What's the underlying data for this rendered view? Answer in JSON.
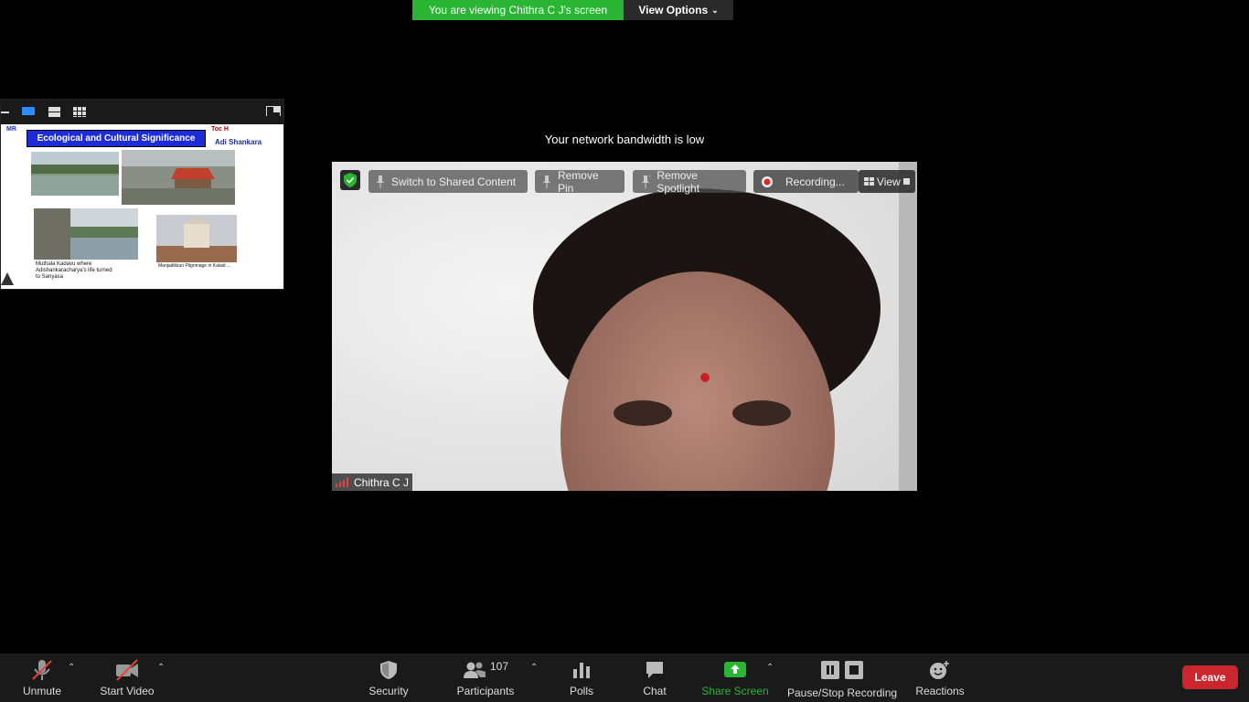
{
  "banner": {
    "viewing_text": "You are viewing Chithra C J's screen",
    "view_options_label": "View Options"
  },
  "thumbnail": {
    "slide_title": "Ecological and Cultural Significance",
    "logo_text_1": "Toc H",
    "logo_text_2": "Adi Shankara",
    "caption_left_1": "Muthala Kadavu  where",
    "caption_left_2": "Adishankaracharya's life turned",
    "caption_left_3": "to Sanyasa",
    "caption_right": "Manjadikkuri Pilgrimage in Kaladi ..."
  },
  "network_notice": "Your network bandwidth is low",
  "video": {
    "switch_label": "Switch to Shared Content",
    "remove_pin_label": "Remove Pin",
    "remove_spotlight_label": "Remove Spotlight",
    "recording_label": "Recording...",
    "view_label": "View",
    "participant_name": "Chithra C J"
  },
  "toolbar": {
    "unmute_label": "Unmute",
    "start_video_label": "Start Video",
    "security_label": "Security",
    "participants_label": "Participants",
    "participants_count": "107",
    "polls_label": "Polls",
    "chat_label": "Chat",
    "share_screen_label": "Share Screen",
    "recording_label": "Pause/Stop Recording",
    "reactions_label": "Reactions",
    "leave_label": "Leave"
  },
  "colors": {
    "banner_green": "#2bb534",
    "share_green": "#2bb534",
    "leave_red": "#c9262e",
    "slide_title_blue": "#1e2cd8",
    "active_layout_blue": "#2d8cff"
  }
}
